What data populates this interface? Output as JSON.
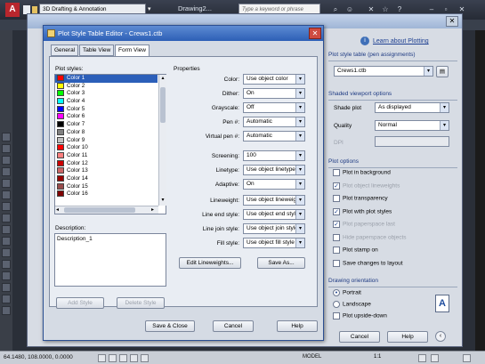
{
  "autocad": {
    "workspace": "3D Drafting & Annotation",
    "doc_title": "Drawing2...",
    "search_placeholder": "Type a keyword or phrase",
    "coords": "64.1480, 108.0000, 0.0000",
    "status_model": "MODEL",
    "status_scale": "1:1"
  },
  "plot_dialog": {
    "help_link": "Learn about Plotting",
    "section_style_table": "Plot style table (pen assignments)",
    "style_table_value": "Crews1.ctb",
    "section_shaded": "Shaded viewport options",
    "shade_plot_label": "Shade plot",
    "shade_plot_value": "As displayed",
    "quality_label": "Quality",
    "quality_value": "Normal",
    "dpi_label": "DPI",
    "section_plot_options": "Plot options",
    "options": [
      {
        "label": "Plot in background",
        "checked": false,
        "enabled": true
      },
      {
        "label": "Plot object lineweights",
        "checked": true,
        "enabled": false
      },
      {
        "label": "Plot transparency",
        "checked": false,
        "enabled": true
      },
      {
        "label": "Plot with plot styles",
        "checked": true,
        "enabled": true
      },
      {
        "label": "Plot paperspace last",
        "checked": true,
        "enabled": false
      },
      {
        "label": "Hide paperspace objects",
        "checked": false,
        "enabled": false
      },
      {
        "label": "Plot stamp on",
        "checked": false,
        "enabled": true
      },
      {
        "label": "Save changes to layout",
        "checked": false,
        "enabled": true
      }
    ],
    "section_orientation": "Drawing orientation",
    "portrait": "Portrait",
    "landscape": "Landscape",
    "upside_down": "Plot upside-down",
    "cancel": "Cancel",
    "help": "Help"
  },
  "pst": {
    "title": "Plot Style Table Editor - Crews1.ctb",
    "tabs": [
      "General",
      "Table View",
      "Form View"
    ],
    "plot_styles_label": "Plot styles:",
    "styles": [
      {
        "name": "Color 1",
        "color": "#ff0000"
      },
      {
        "name": "Color 2",
        "color": "#ffff00"
      },
      {
        "name": "Color 3",
        "color": "#00ff00"
      },
      {
        "name": "Color 4",
        "color": "#00ffff"
      },
      {
        "name": "Color 5",
        "color": "#0000ff"
      },
      {
        "name": "Color 6",
        "color": "#ff00ff"
      },
      {
        "name": "Color 7",
        "color": "#000000"
      },
      {
        "name": "Color 8",
        "color": "#808080"
      },
      {
        "name": "Color 9",
        "color": "#c0c0c0"
      },
      {
        "name": "Color 10",
        "color": "#ff0000"
      },
      {
        "name": "Color 11",
        "color": "#ff7f7f"
      },
      {
        "name": "Color 12",
        "color": "#cc0000"
      },
      {
        "name": "Color 13",
        "color": "#cc6666"
      },
      {
        "name": "Color 14",
        "color": "#990000"
      },
      {
        "name": "Color 15",
        "color": "#994c4c"
      },
      {
        "name": "Color 16",
        "color": "#7f0000"
      }
    ],
    "description_label": "Description:",
    "description_value": "Description_1",
    "add_style": "Add Style",
    "delete_style": "Delete Style",
    "properties_label": "Properties",
    "properties": [
      {
        "label": "Color:",
        "value": "Use object color"
      },
      {
        "label": "Dither:",
        "value": "On"
      },
      {
        "label": "Grayscale:",
        "value": "Off"
      },
      {
        "label": "Pen #:",
        "value": "Automatic"
      },
      {
        "label": "Virtual pen #:",
        "value": "Automatic"
      },
      {
        "label": "Screening:",
        "value": "100"
      },
      {
        "label": "Linetype:",
        "value": "Use object linetype"
      },
      {
        "label": "Adaptive:",
        "value": "On"
      },
      {
        "label": "Lineweight:",
        "value": "Use object lineweight"
      },
      {
        "label": "Line end style:",
        "value": "Use object end style"
      },
      {
        "label": "Line join style:",
        "value": "Use object join style"
      },
      {
        "label": "Fill style:",
        "value": "Use object fill style"
      }
    ],
    "edit_lineweights": "Edit Lineweights...",
    "save_as": "Save As...",
    "save_close": "Save & Close",
    "cancel": "Cancel",
    "help": "Help"
  }
}
